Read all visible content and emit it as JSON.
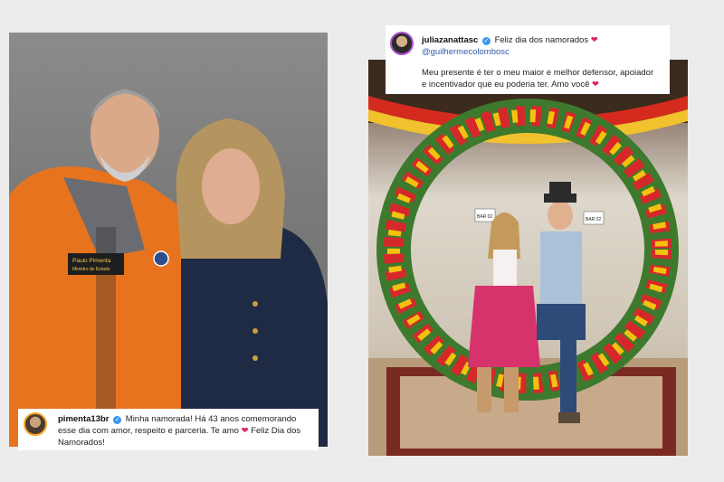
{
  "left_post": {
    "username": "pimenta13br",
    "caption_part1": "Minha namorada! Há 43 anos comemorando esse dia com amor, respeito e parceria. Te amo",
    "caption_part2": "Feliz Dia dos Namorados!",
    "badge_line1": "Paulo Pimenta",
    "badge_line2": "Ministro de Estado"
  },
  "right_post": {
    "username": "juliazanattasc",
    "headline": "Feliz dia dos namorados",
    "mention": "@guilhermecolombosc",
    "caption_part1": "Meu presente é ter o meu maior e melhor defensor, apoiador e incentivador que eu poderia ter. Amo você",
    "sign_1": "BAR 02",
    "sign_2": "BAR 02"
  },
  "colors": {
    "heart": "#e0245e",
    "verified": "#3897f0",
    "jacket": "#e8731e",
    "dirndl": "#d6336c"
  },
  "icons": [
    "verified-icon",
    "heart-icon",
    "avatar-image"
  ]
}
